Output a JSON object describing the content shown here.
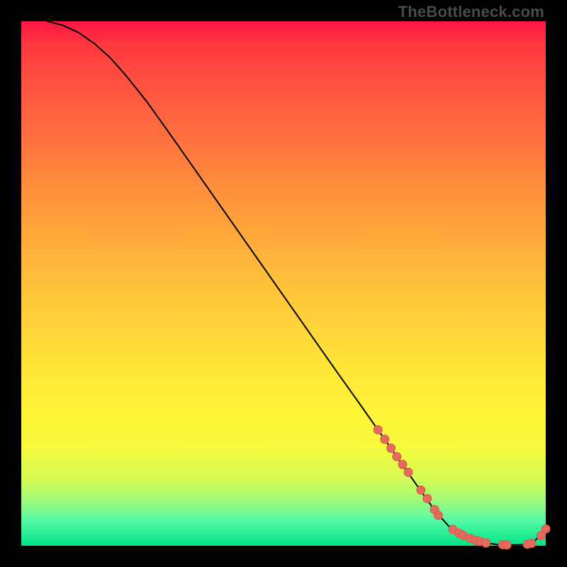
{
  "watermark": "TheBottleneck.com",
  "chart_data": {
    "type": "line",
    "title": "",
    "xlabel": "",
    "ylabel": "",
    "xlim": [
      0,
      100
    ],
    "ylim": [
      0,
      100
    ],
    "grid": false,
    "series": [
      {
        "name": "curve",
        "style": "line",
        "color": "#000000",
        "x": [
          5,
          8,
          11,
          14,
          17,
          20,
          24,
          28,
          32,
          36,
          40,
          44,
          48,
          52,
          56,
          60,
          64,
          68,
          72,
          76,
          79,
          82,
          85,
          88,
          91,
          93.5,
          96,
          98,
          100
        ],
        "y": [
          100,
          99.2,
          97.8,
          95.7,
          93.0,
          89.6,
          84.6,
          79.0,
          73.3,
          67.6,
          61.9,
          56.2,
          50.5,
          44.8,
          39.1,
          33.4,
          27.8,
          22.1,
          16.4,
          10.7,
          6.5,
          3.2,
          1.5,
          0.6,
          0.2,
          0.15,
          0.2,
          1.0,
          3.2
        ]
      },
      {
        "name": "markers",
        "style": "scatter",
        "color": "#e36a5c",
        "x": [
          68.0,
          69.3,
          70.5,
          71.6,
          72.7,
          73.8,
          76.2,
          77.4,
          78.8,
          79.5,
          82.3,
          83.4,
          84.2,
          85.6,
          86.7,
          87.5,
          88.6,
          91.8,
          92.6,
          96.5,
          97.3,
          99.1,
          100.0
        ],
        "y": [
          22.1,
          20.3,
          18.6,
          17.0,
          15.5,
          14.0,
          10.6,
          9.0,
          6.9,
          5.8,
          3.1,
          2.4,
          2.0,
          1.4,
          1.0,
          0.8,
          0.5,
          0.2,
          0.15,
          0.28,
          0.45,
          1.9,
          3.2
        ]
      }
    ]
  },
  "colors": {
    "marker_fill": "#e36a5c",
    "marker_stroke": "#d85a4c",
    "curve_stroke": "#000000"
  }
}
